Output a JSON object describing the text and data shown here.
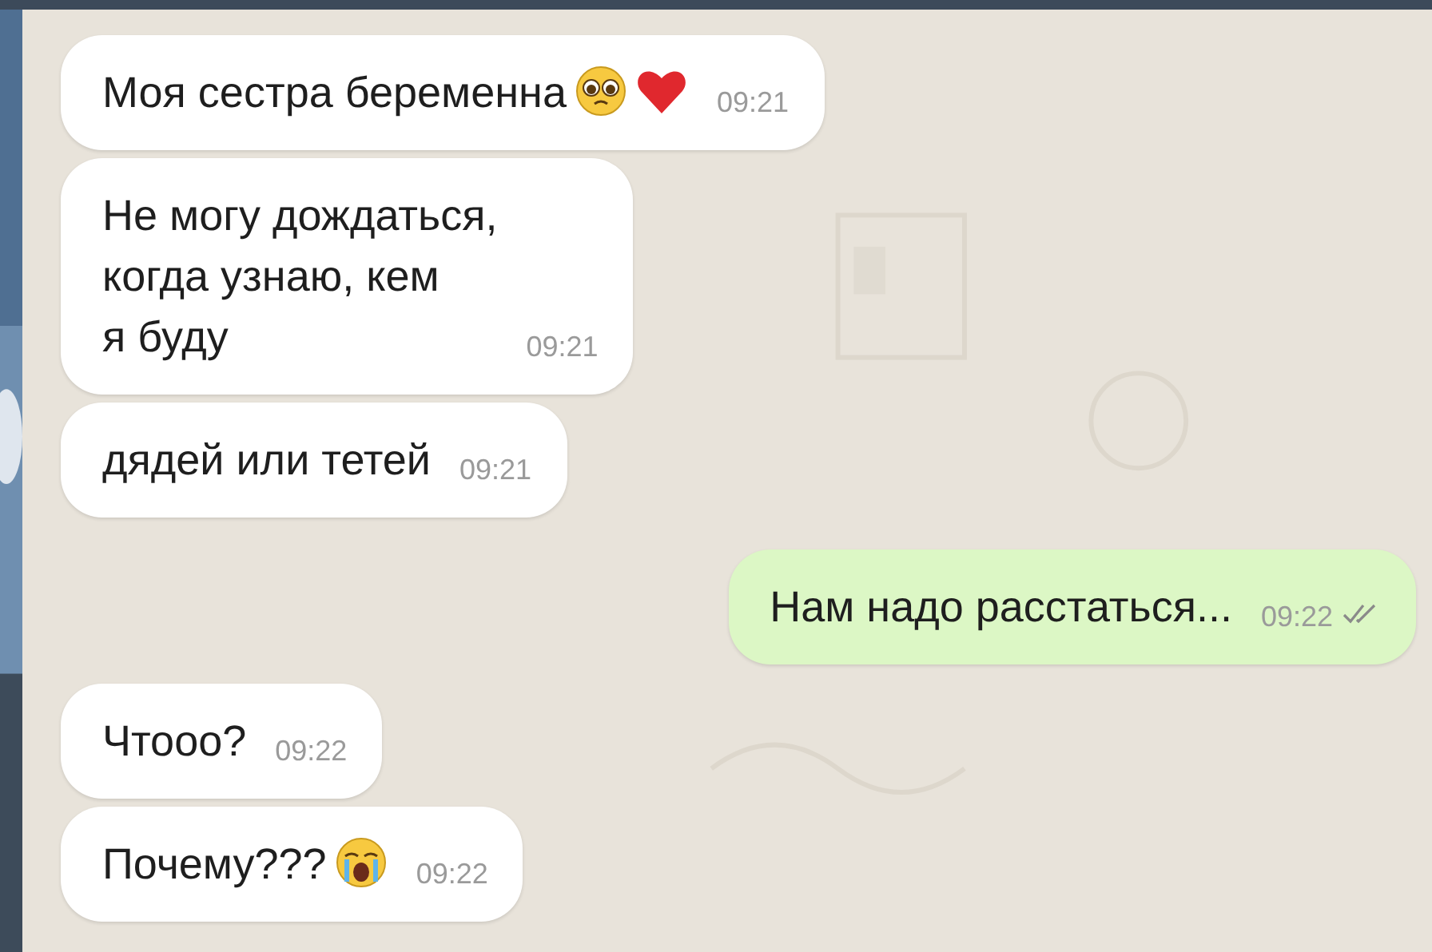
{
  "messages": [
    {
      "kind": "incoming",
      "text": "Моя сестра беременна",
      "emoji": [
        {
          "kind": "pleading-face"
        },
        {
          "kind": "heart"
        }
      ],
      "time": "09:21"
    },
    {
      "kind": "incoming",
      "text": "Не могу дождаться,\nкогда узнаю, кем\nя буду",
      "time": "09:21"
    },
    {
      "kind": "incoming",
      "text": "дядей или тетей",
      "time": "09:21"
    },
    {
      "kind": "outgoing",
      "text": "Нам надо расстаться...",
      "time": "09:22",
      "read": true
    },
    {
      "kind": "incoming",
      "text": "Чтооо?",
      "time": "09:22"
    },
    {
      "kind": "incoming",
      "text": "Почему???",
      "emoji": [
        {
          "kind": "crying-face"
        }
      ],
      "time": "09:22"
    }
  ]
}
